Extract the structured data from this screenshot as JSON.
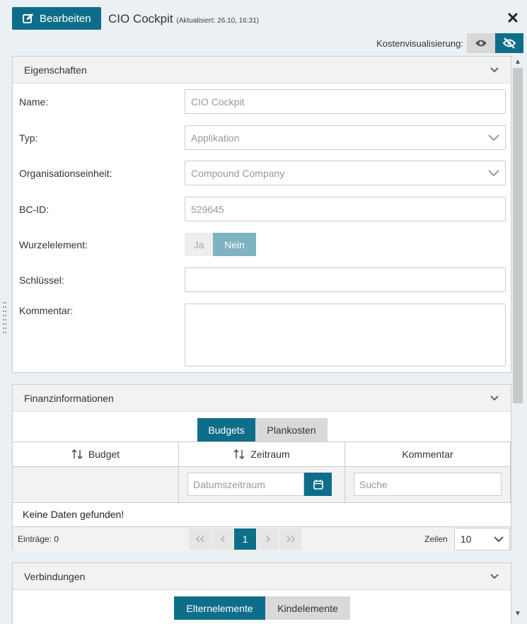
{
  "header": {
    "edit_label": "Bearbeiten",
    "title": "CIO Cockpit",
    "updated": "(Aktualisiert: 26.10, 16:31)",
    "cost_vis_label": "Kostenvisualisierung:"
  },
  "eigenschaften": {
    "title": "Eigenschaften",
    "name_label": "Name:",
    "name_value": "CIO Cockpit",
    "typ_label": "Typ:",
    "typ_value": "Applikation",
    "org_label": "Organisationseinheit:",
    "org_value": "Compound Company",
    "bcid_label": "BC-ID:",
    "bcid_value": "529645",
    "wurzel_label": "Wurzelelement:",
    "wurzel_ja": "Ja",
    "wurzel_nein": "Nein",
    "schluessel_label": "Schlüssel:",
    "schluessel_value": "",
    "kommentar_label": "Kommentar:",
    "kommentar_value": ""
  },
  "finanz": {
    "title": "Finanzinformationen",
    "tab_budgets": "Budgets",
    "tab_plankosten": "Plankosten",
    "col_budget": "Budget",
    "col_zeitraum": "Zeitraum",
    "col_kommentar": "Kommentar",
    "date_placeholder": "Datumszeitraum",
    "search_placeholder": "Suche",
    "no_data": "Keine Daten gefunden!",
    "entries": "Einträge: 0",
    "page_current": "1",
    "rows_label": "Zeilen",
    "rows_value": "10"
  },
  "verbindungen": {
    "title": "Verbindungen",
    "tab_eltern": "Elternelemente",
    "tab_kinder": "Kindelemente"
  },
  "colors": {
    "accent": "#0e6e8a",
    "toggle_active": "#7fb3c2",
    "background": "#eaf0f3"
  }
}
